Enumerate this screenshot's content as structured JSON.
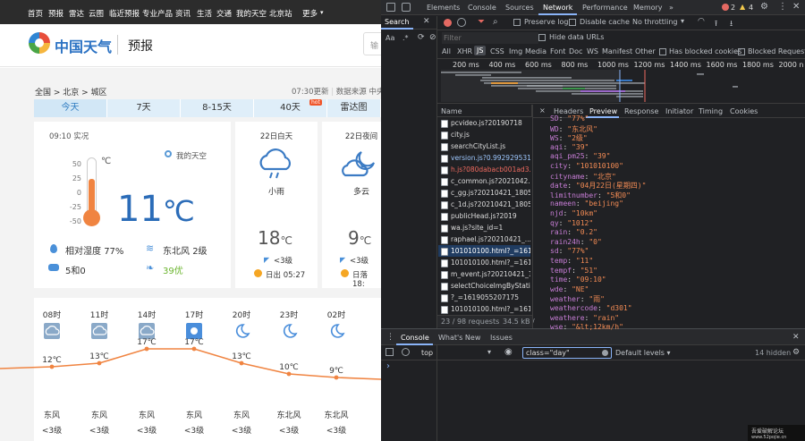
{
  "site": {
    "nav": [
      "首页",
      "预报",
      "雷达",
      "云图",
      "临近预报",
      "专业产品",
      "资讯",
      "生活",
      "交通",
      "我的天空",
      "北京站",
      "更多"
    ],
    "logo_text": "中国天气",
    "section_title": "预报",
    "search_label": "输",
    "breadcrumb": "全国 > 北京 > 城区",
    "updated": "07:30更新",
    "data_source": "数据来源 中央气",
    "tabs": [
      "今天",
      "7天",
      "8-15天",
      "40天",
      "雷达图"
    ],
    "hot_badge": "hot",
    "now": {
      "time": "09:10 实况",
      "my_sky": "我的天空",
      "scale": [
        "50",
        "25",
        "0",
        "-25",
        "-50"
      ],
      "unit": "℃",
      "temp": "11",
      "temp_unit": "℃",
      "humidity_label": "相对湿度",
      "humidity": "77%",
      "wind_dir": "东北风",
      "wind_level": "2级",
      "car_limit": "5和0",
      "aqi": "39优"
    },
    "day": {
      "title": "22日白天",
      "weather": "小雨",
      "temp": "18",
      "unit": "℃",
      "wind": "<3级",
      "sun": "日出 05:27"
    },
    "night": {
      "title": "22日夜间",
      "weather": "多云",
      "temp": "9",
      "unit": "℃",
      "wind": "<3级",
      "sun": "日落 18:"
    },
    "hourly": {
      "times": [
        "08时",
        "11时",
        "14时",
        "17时",
        "20时",
        "23时",
        "02时"
      ],
      "icons": [
        "cloud-rain-icon",
        "cloud-rain-icon",
        "cloud-rain-icon",
        "sun-icon",
        "moon-icon",
        "moon-icon",
        "moon-icon"
      ],
      "temps": [
        12,
        13,
        17,
        17,
        13,
        10,
        9
      ],
      "temp_labels": [
        "12℃",
        "13℃",
        "17℃",
        "17℃",
        "13℃",
        "10℃",
        "9℃"
      ],
      "winds": [
        "东风",
        "东风",
        "东风",
        "东风",
        "东风",
        "东北风",
        "东北风",
        "东北风"
      ],
      "levels": [
        "<3级",
        "<3级",
        "<3级",
        "<3级",
        "<3级",
        "<3级",
        "<3级",
        "<3级"
      ]
    }
  },
  "devtools": {
    "tabs": [
      "Elements",
      "Console",
      "Sources",
      "Network",
      "Performance",
      "Memory"
    ],
    "more": "»",
    "errors": "2",
    "warnings": "4",
    "search_tab": "Search",
    "aa": "Aa",
    "regex": ".*",
    "preserve_log": "Preserve log",
    "disable_cache": "Disable cache",
    "throttling": "No throttling",
    "filter_placeholder": "Filter",
    "hide_data_urls": "Hide data URLs",
    "types": [
      "All",
      "XHR",
      "JS",
      "CSS",
      "Img",
      "Media",
      "Font",
      "Doc",
      "WS",
      "Manifest",
      "Other"
    ],
    "blocked_cookies": "Has blocked cookies",
    "blocked_requests": "Blocked Requests",
    "timeline": [
      "200 ms",
      "400 ms",
      "600 ms",
      "800 ms",
      "1000 ms",
      "1200 ms",
      "1400 ms",
      "1600 ms",
      "1800 ms",
      "2000 n"
    ],
    "name_header": "Name",
    "requests": [
      {
        "name": "pcvideo.js?20190718",
        "style": ""
      },
      {
        "name": "city.js",
        "style": ""
      },
      {
        "name": "searchCityList.js",
        "style": ""
      },
      {
        "name": "version.js?0.992929531...",
        "style": "blue"
      },
      {
        "name": "h.js?080dabacb001ad3...",
        "style": "red"
      },
      {
        "name": "c_common.js?2021042...",
        "style": ""
      },
      {
        "name": "c_gg.js?20210421_1805...",
        "style": ""
      },
      {
        "name": "c_1d.js?20210421_1805...",
        "style": ""
      },
      {
        "name": "publicHead.js?2019",
        "style": ""
      },
      {
        "name": "wa.js?site_id=1",
        "style": ""
      },
      {
        "name": "raphael.js?20210421_...",
        "style": ""
      },
      {
        "name": "101010100.html?_=161...",
        "style": "sel"
      },
      {
        "name": "101010100.html?_=161...",
        "style": ""
      },
      {
        "name": "m_event.js?20210421_1...",
        "style": ""
      },
      {
        "name": "selectChoiceImgByStati...",
        "style": ""
      },
      {
        "name": "?_=1619055207175",
        "style": ""
      },
      {
        "name": "101010100.html?_=161...",
        "style": ""
      }
    ],
    "summary_requests": "23 / 98 requests",
    "summary_size": "34.5 kB /",
    "detail_tabs": [
      "×",
      "Headers",
      "Preview",
      "Response",
      "Initiator",
      "Timing",
      "Cookies"
    ],
    "preview": [
      {
        "k": "SD",
        "v": "\"77%\""
      },
      {
        "k": "WD",
        "v": "\"东北风\""
      },
      {
        "k": "WS",
        "v": "\"2级\""
      },
      {
        "k": "aqi",
        "v": "\"39\""
      },
      {
        "k": "aqi_pm25",
        "v": "\"39\""
      },
      {
        "k": "city",
        "v": "\"101010100\""
      },
      {
        "k": "cityname",
        "v": "\"北京\""
      },
      {
        "k": "date",
        "v": "\"04月22日(星期四)\""
      },
      {
        "k": "limitnumber",
        "v": "\"5和0\""
      },
      {
        "k": "nameen",
        "v": "\"beijing\""
      },
      {
        "k": "njd",
        "v": "\"10km\""
      },
      {
        "k": "qy",
        "v": "\"1012\""
      },
      {
        "k": "rain",
        "v": "\"0.2\""
      },
      {
        "k": "rain24h",
        "v": "\"0\""
      },
      {
        "k": "sd",
        "v": "\"77%\""
      },
      {
        "k": "temp",
        "v": "\"11\""
      },
      {
        "k": "tempf",
        "v": "\"51\""
      },
      {
        "k": "time",
        "v": "\"09:10\""
      },
      {
        "k": "wde",
        "v": "\"NE\""
      },
      {
        "k": "weather",
        "v": "\"雨\""
      },
      {
        "k": "weathercode",
        "v": "\"d301\""
      },
      {
        "k": "weathere",
        "v": "\"rain\""
      },
      {
        "k": "wse",
        "v": "\"&lt;12km/h\""
      }
    ],
    "console_tabs": [
      "Console",
      "What's New",
      "Issues"
    ],
    "context": "top",
    "console_filter": "class=\"day\"",
    "levels": "Default levels ▾",
    "hidden": "14 hidden",
    "prompt": "›"
  },
  "watermark": [
    "吾爱破解论坛",
    "www.52pojie.cn"
  ]
}
